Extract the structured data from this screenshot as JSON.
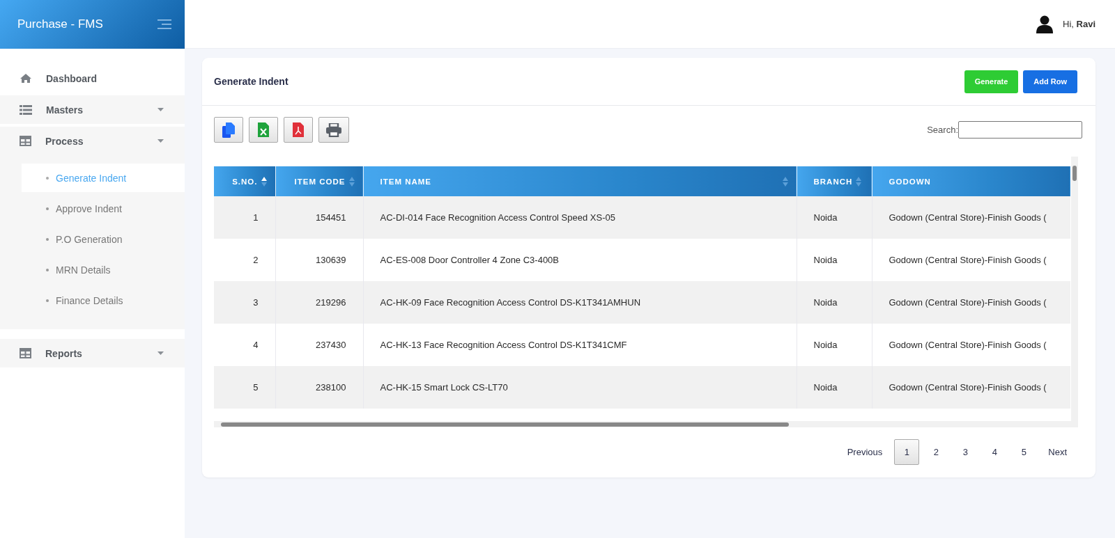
{
  "brand": {
    "title": "Purchase - FMS"
  },
  "header": {
    "greeting": "Hi, **Ravi**"
  },
  "sidebar": {
    "items": [
      {
        "label": "Dashboard",
        "kind": "home"
      },
      {
        "label": "Masters",
        "kind": "list"
      },
      {
        "label": "Process",
        "kind": "table",
        "children": [
          {
            "label": "Generate Indent",
            "selected": true
          },
          {
            "label": "Approve Indent",
            "selected": false
          },
          {
            "label": "P.O Generation",
            "selected": false
          },
          {
            "label": "MRN Details",
            "selected": false
          },
          {
            "label": "Finance Details",
            "selected": false
          }
        ]
      },
      {
        "label": "Reports",
        "kind": "table"
      }
    ]
  },
  "card": {
    "title": "Generate Indent",
    "actions": [
      {
        "label": "Generate",
        "kind": "success"
      },
      {
        "label": "Add Row",
        "kind": "primary"
      }
    ]
  },
  "export_buttons": [
    {
      "kind": "copy"
    },
    {
      "kind": "excel"
    },
    {
      "kind": "pdf"
    },
    {
      "kind": "print"
    }
  ],
  "search": {
    "label": "Search:"
  },
  "table": {
    "columns": [
      {
        "label": "S.NO.",
        "sortable": true,
        "sorted": true
      },
      {
        "label": "ITEM CODE",
        "sortable": true,
        "sorted": false
      },
      {
        "label": "ITEM NAME",
        "sortable": true,
        "sorted": false
      },
      {
        "label": "BRANCH",
        "sortable": true,
        "sorted": false
      },
      {
        "label": "GODOWN",
        "sortable": false
      }
    ],
    "rows": [
      [
        "1",
        "154451",
        "AC-DI-014 Face Recognition Access Control Speed XS-05",
        "Noida",
        "Godown (Central Store)-Finish Goods ("
      ],
      [
        "2",
        "130639",
        "AC-ES-008 Door Controller 4 Zone C3-400B",
        "Noida",
        "Godown (Central Store)-Finish Goods ("
      ],
      [
        "3",
        "219296",
        "AC-HK-09 Face Recognition Access Control DS-K1T341AMHUN",
        "Noida",
        "Godown (Central Store)-Finish Goods ("
      ],
      [
        "4",
        "237430",
        "AC-HK-13 Face Recognition Access Control DS-K1T341CMF",
        "Noida",
        "Godown (Central Store)-Finish Goods ("
      ],
      [
        "5",
        "238100",
        "AC-HK-15 Smart Lock CS-LT70",
        "Noida",
        "Godown (Central Store)-Finish Goods ("
      ]
    ]
  },
  "pagination": {
    "previous": "Previous",
    "next": "Next",
    "pages": [
      {
        "label": "1",
        "selected": true
      },
      {
        "label": "2",
        "selected": false
      },
      {
        "label": "3",
        "selected": false
      },
      {
        "label": "4",
        "selected": false
      },
      {
        "label": "5",
        "selected": false
      }
    ]
  }
}
